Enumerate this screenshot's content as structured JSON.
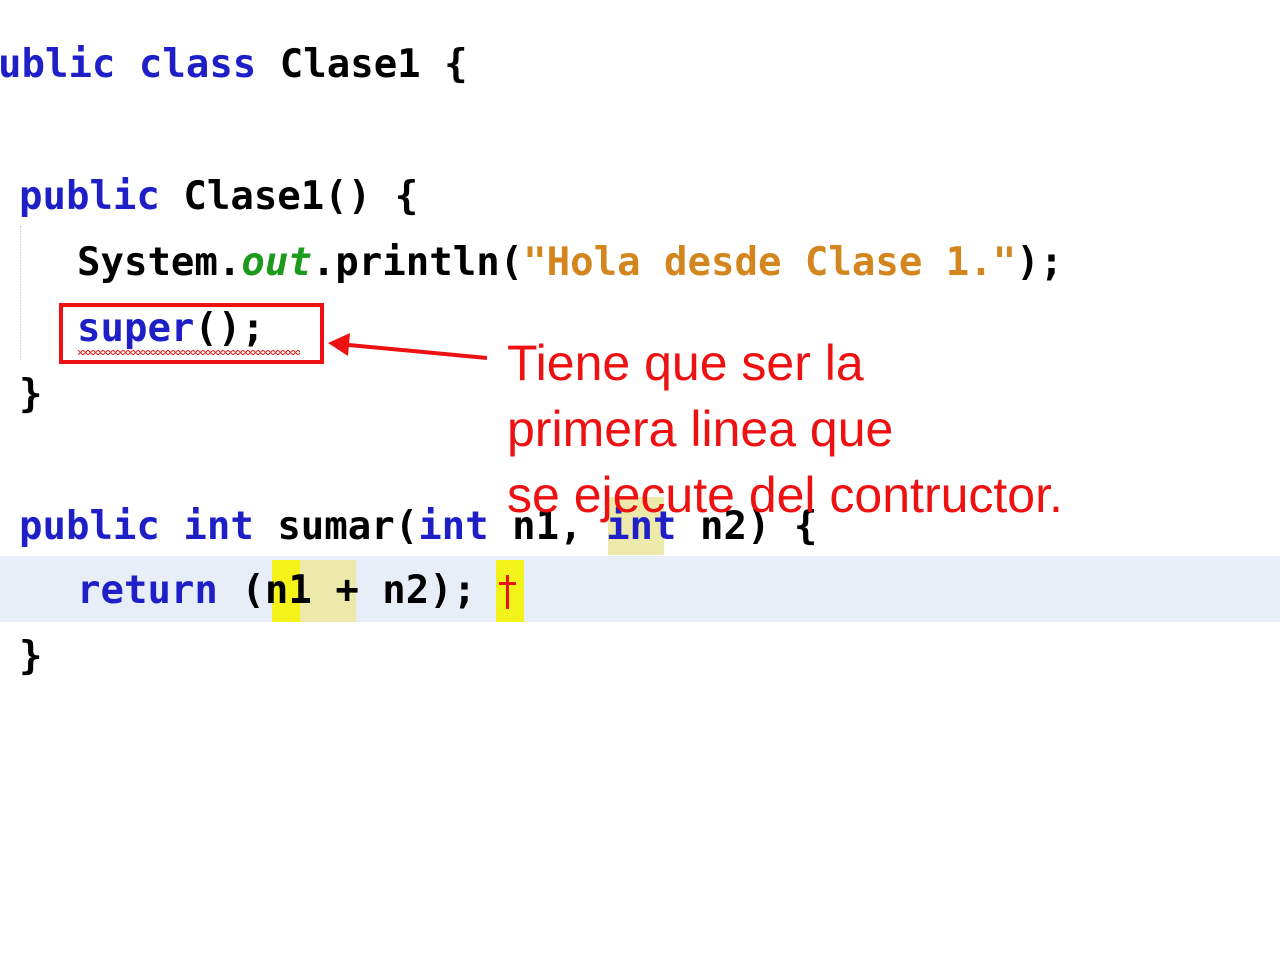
{
  "code": {
    "class_decl": {
      "modifier": "ublic",
      "keyword": "class",
      "name": "Clase1 {"
    },
    "constructor_decl": {
      "modifier": "public",
      "name": "Clase1() {"
    },
    "println_stmt": {
      "receiver": "System.",
      "field": "out",
      "method": ".println(",
      "string": "\"Hola desde Clase 1.\"",
      "end": ");"
    },
    "super_stmt": {
      "keyword": "super",
      "rest": "();"
    },
    "constructor_close": "}",
    "method_decl": {
      "modifier": "public",
      "return_type": "int",
      "name": "sumar(",
      "param1_type": "int",
      "param1_name": "n1",
      "sep": ",",
      "param2_type": "int",
      "param2_rest": "n2) {"
    },
    "return_stmt": {
      "keyword": "return",
      "open_paren": "(",
      "left": "n1",
      "operator": "+",
      "right": "n2",
      "close": ");"
    },
    "method_close": "}"
  },
  "annotation": {
    "lines": [
      "Tiene que ser la",
      "primera linea que",
      "se ejecute del contructor."
    ],
    "color": "#ee1111"
  },
  "colors": {
    "keyword": "#1f1fc8",
    "string": "#d4861e",
    "field": "#1c9a1c",
    "current_line": "#e8eef8",
    "occurrence": "#ece9ab",
    "bracket_match": "#f3f31a"
  },
  "icons": {
    "arrow": "left-arrow-icon",
    "error_marker": "error-squiggle-icon",
    "caret": "text-caret-icon"
  }
}
